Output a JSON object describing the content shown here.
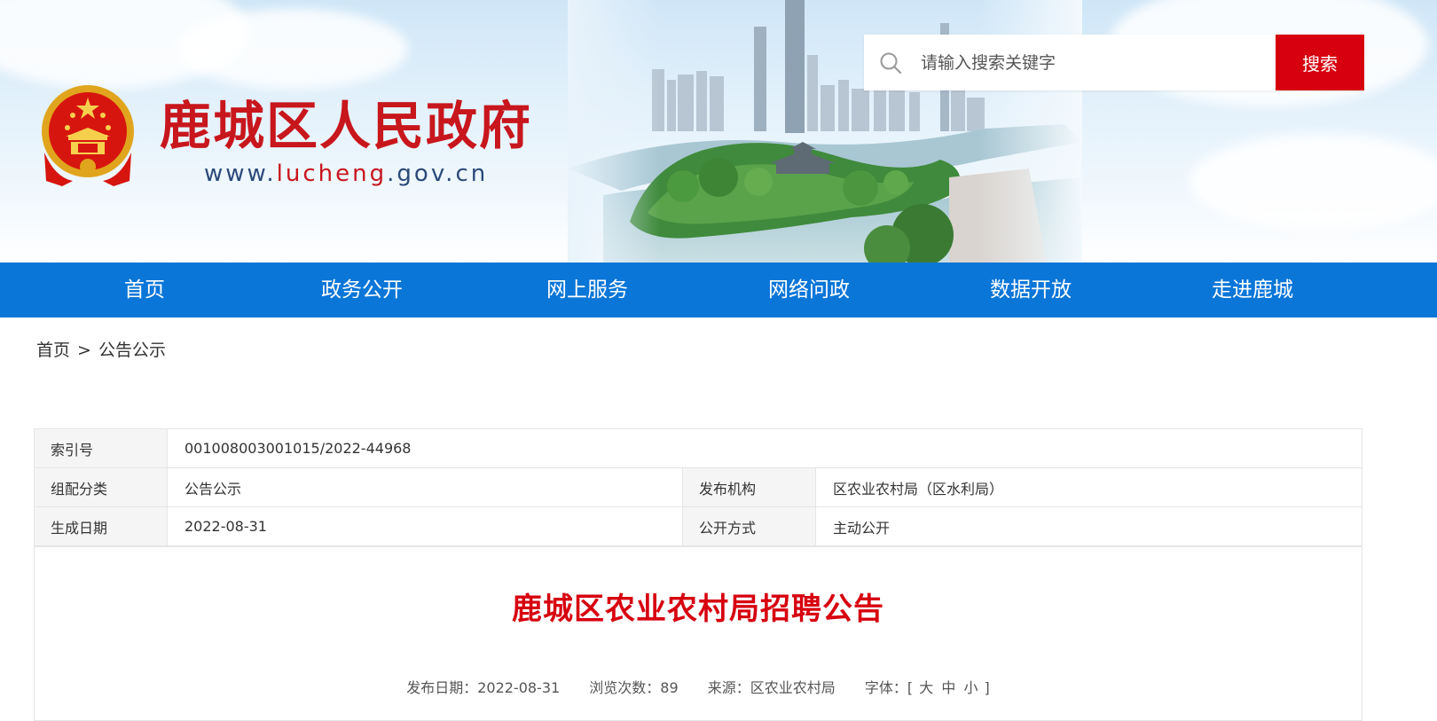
{
  "header": {
    "site_name": "鹿城区人民政府",
    "site_url_prefix": "www.",
    "site_url_accent": "lucheng",
    "site_url_suffix": ".gov.cn",
    "search": {
      "placeholder": "请输入搜索关键字",
      "button_label": "搜索",
      "icon": "search-icon"
    }
  },
  "nav": {
    "items": [
      "首页",
      "政务公开",
      "网上服务",
      "网络问政",
      "数据开放",
      "走进鹿城"
    ]
  },
  "breadcrumb": {
    "home": "首页",
    "separator": ">",
    "current": "公告公示"
  },
  "meta_table": {
    "rows": [
      {
        "label": "索引号",
        "value": "001008003001015/2022-44968"
      },
      {
        "label": "组配分类",
        "value": "公告公示",
        "label2": "发布机构",
        "value2": "区农业农村局（区水利局）"
      },
      {
        "label": "生成日期",
        "value": "2022-08-31",
        "label2": "公开方式",
        "value2": "主动公开"
      }
    ]
  },
  "article": {
    "title": "鹿城区农业农村局招聘公告",
    "publish_date": "发布日期：2022-08-31",
    "views": "浏览次数：89",
    "source": "来源：区农业农村局",
    "font_label": "字体：[",
    "font_large": "大",
    "font_medium": "中",
    "font_small": "小",
    "font_close": "]"
  },
  "colors": {
    "brand_red": "#d7000f",
    "nav_blue": "#0a76d8"
  }
}
